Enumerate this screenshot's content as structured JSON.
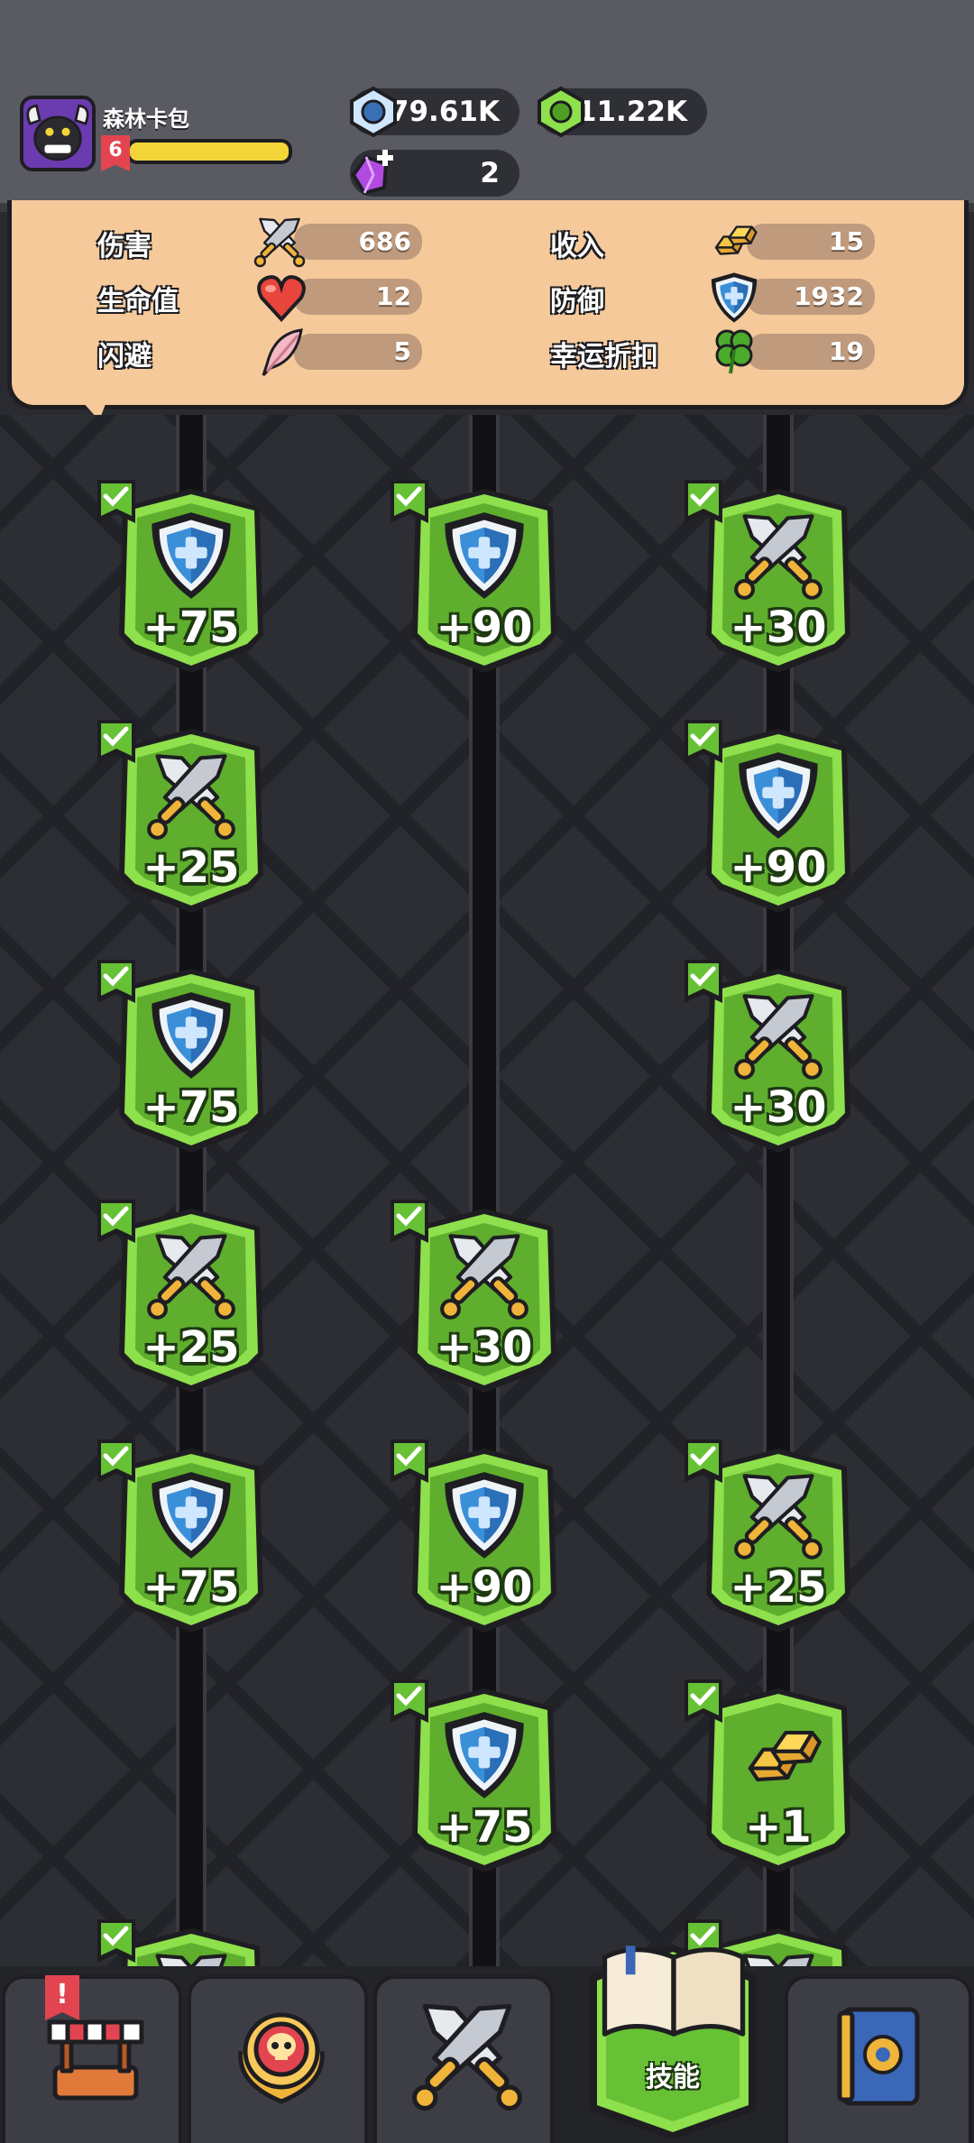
{
  "player": {
    "name": "森林卡包",
    "level": "6",
    "xp_progress": 1.0
  },
  "currencies": {
    "gems": {
      "value": "79.61K",
      "icon": "blue-gem-icon"
    },
    "coins": {
      "value": "11.22K",
      "icon": "green-gem-icon"
    },
    "crystals": {
      "value": "2",
      "icon": "purple-crystal-plus-icon"
    }
  },
  "stats": {
    "damage": {
      "label": "伤害",
      "value": "686",
      "icon": "crossed-swords-icon"
    },
    "health": {
      "label": "生命值",
      "value": "12",
      "icon": "heart-icon"
    },
    "dodge": {
      "label": "闪避",
      "value": "5",
      "icon": "feather-icon"
    },
    "income": {
      "label": "收入",
      "value": "15",
      "icon": "gold-bars-icon"
    },
    "defense": {
      "label": "防御",
      "value": "1932",
      "icon": "shield-icon"
    },
    "luck": {
      "label": "幸运折扣",
      "value": "19",
      "icon": "clover-icon"
    }
  },
  "skills": {
    "col1": [
      {
        "type": "shield",
        "value": "+75",
        "unlocked": true
      },
      {
        "type": "swords",
        "value": "+25",
        "unlocked": true
      },
      {
        "type": "shield",
        "value": "+75",
        "unlocked": true
      },
      {
        "type": "swords",
        "value": "+25",
        "unlocked": true
      },
      {
        "type": "shield",
        "value": "+75",
        "unlocked": true
      },
      {
        "type": "swords",
        "value": "",
        "unlocked": true
      }
    ],
    "col2": [
      {
        "type": "shield",
        "value": "+90",
        "unlocked": true
      },
      {
        "type": "swords",
        "value": "+30",
        "unlocked": true
      },
      {
        "type": "shield",
        "value": "+90",
        "unlocked": true
      },
      {
        "type": "shield",
        "value": "+75",
        "unlocked": true
      }
    ],
    "col3": [
      {
        "type": "swords",
        "value": "+30",
        "unlocked": true
      },
      {
        "type": "shield",
        "value": "+90",
        "unlocked": true
      },
      {
        "type": "swords",
        "value": "+30",
        "unlocked": true
      },
      {
        "type": "swords",
        "value": "+25",
        "unlocked": true
      },
      {
        "type": "gold",
        "value": "+1",
        "unlocked": true
      },
      {
        "type": "swords",
        "value": "",
        "unlocked": true
      }
    ]
  },
  "nav": {
    "shop": {
      "icon": "shop-stall-icon",
      "badge": "!"
    },
    "boss": {
      "icon": "skull-emblem-icon"
    },
    "battle": {
      "icon": "crossed-swords-icon"
    },
    "skills": {
      "icon": "open-book-icon",
      "label": "技能",
      "active": true
    },
    "settings": {
      "icon": "gear-book-icon"
    }
  },
  "colors": {
    "node_green": "#67c135",
    "node_light": "#8ee04c",
    "shield_blue": "#3a8fd9",
    "stats_panel": "#f5c99a",
    "header": "#5a5a62"
  }
}
